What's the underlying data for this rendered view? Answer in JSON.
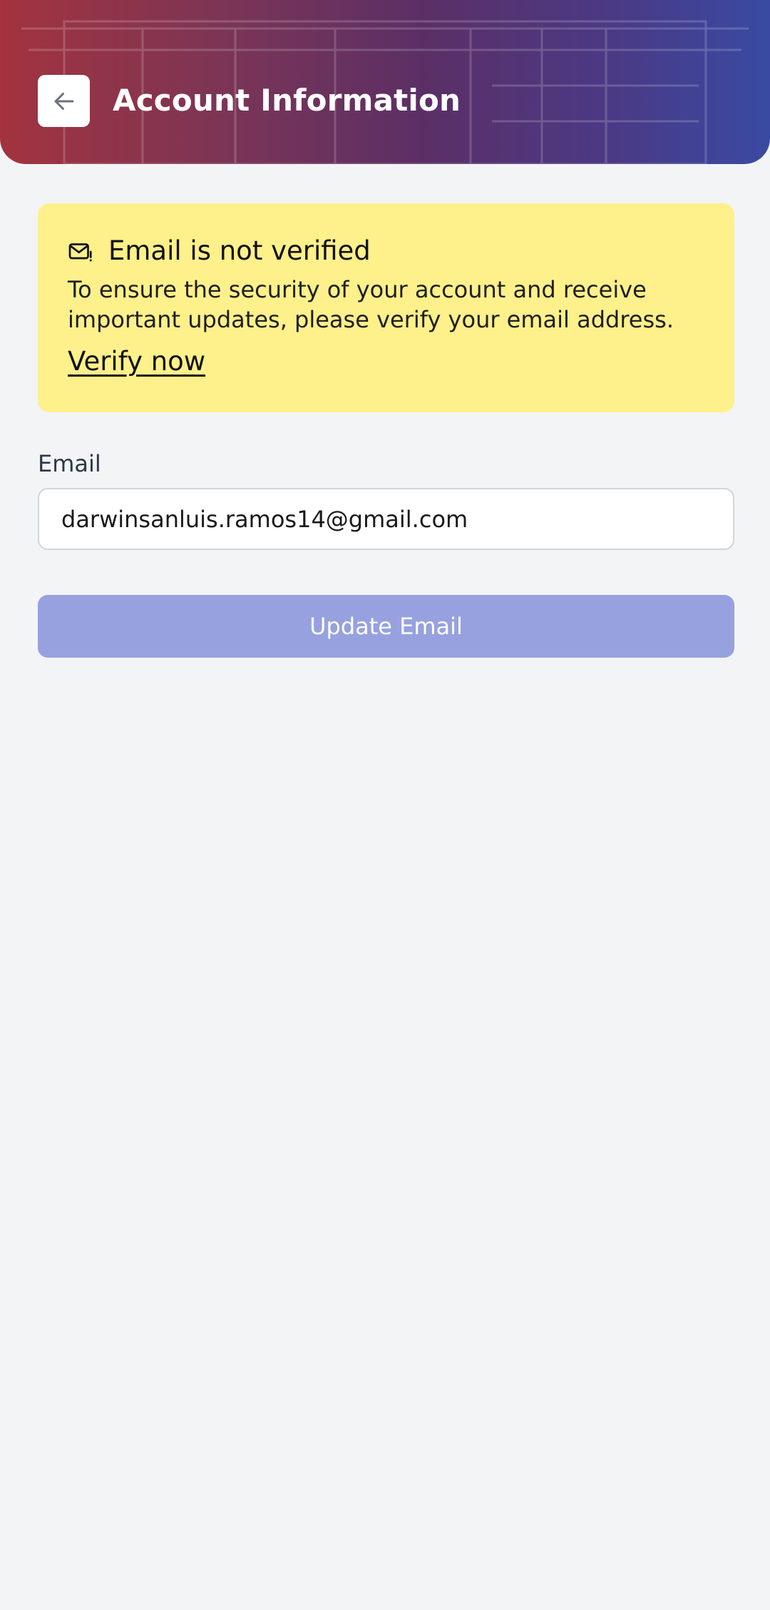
{
  "header": {
    "title": "Account Information",
    "back_icon": "arrow-left-icon"
  },
  "alert": {
    "icon": "mail-warning-icon",
    "title": "Email is not verified",
    "body": "To ensure the security of your account and receive important updates, please verify your email address.",
    "link_label": "Verify now",
    "background_color": "#fef08a"
  },
  "form": {
    "email_label": "Email",
    "email_value": "darwinsanluis.ramos14@gmail.com",
    "submit_label": "Update Email",
    "submit_color": "#97a1df"
  }
}
